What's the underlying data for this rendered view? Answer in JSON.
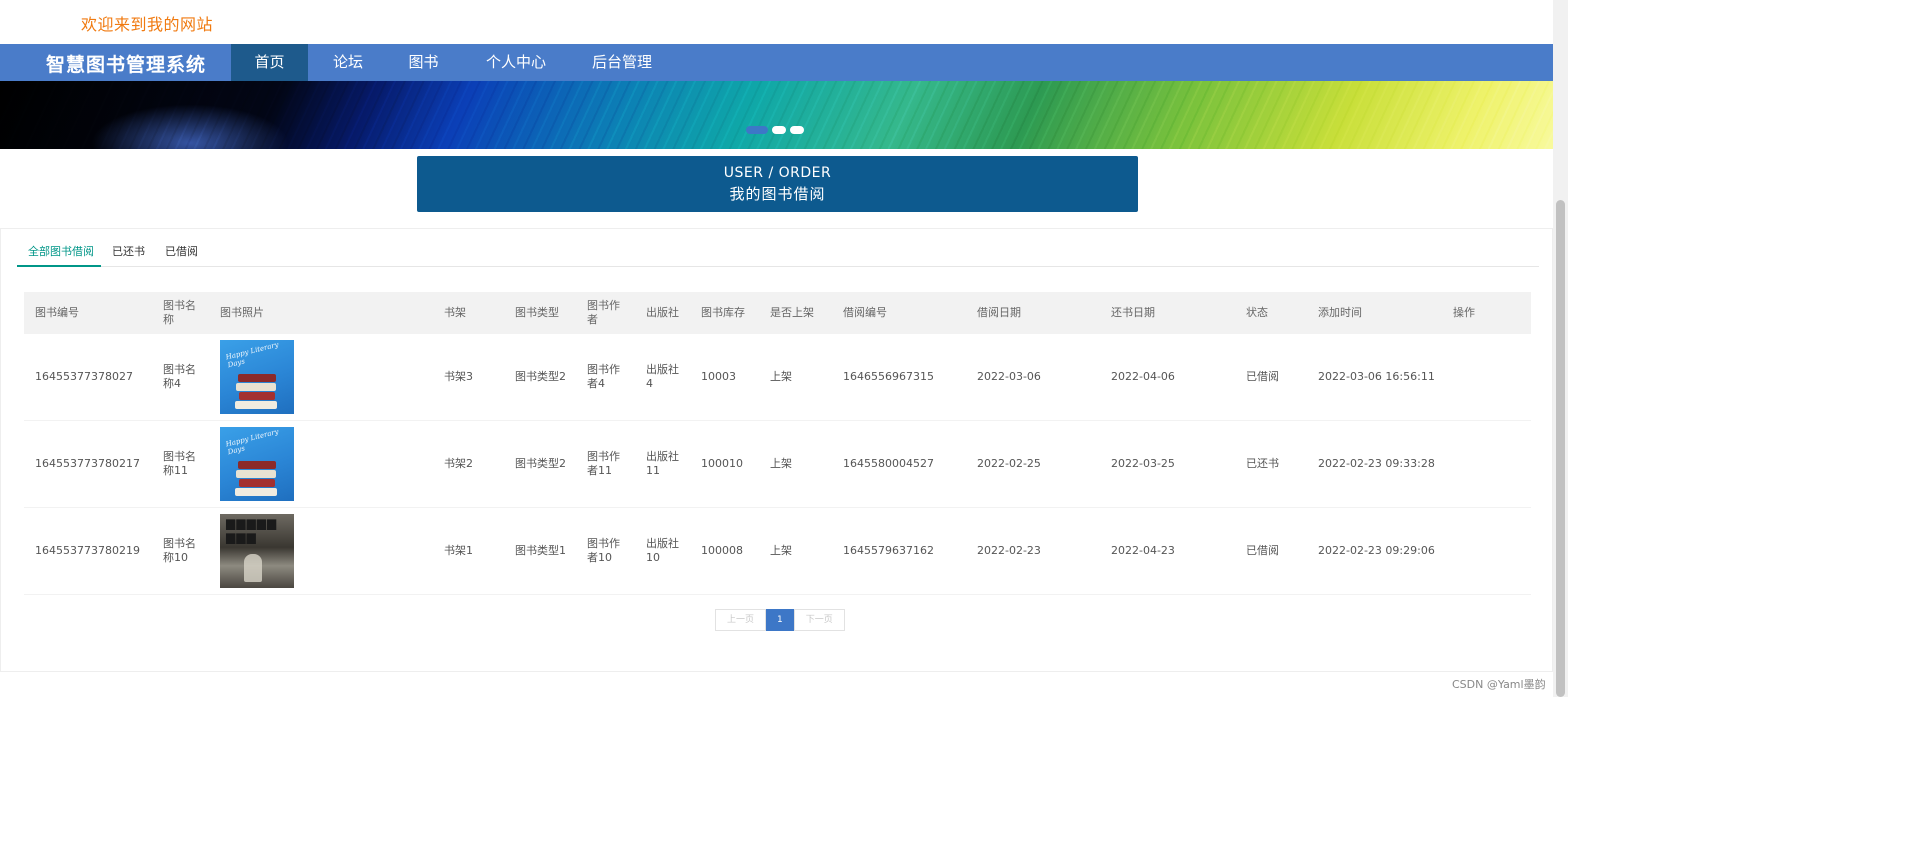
{
  "welcome_text": "欢迎来到我的网站",
  "nav": {
    "brand": "智慧图书管理系统",
    "items": [
      "首页",
      "论坛",
      "图书",
      "个人中心",
      "后台管理"
    ]
  },
  "title": {
    "en": "USER / ORDER",
    "cn": "我的图书借阅"
  },
  "tabs": [
    "全部图书借阅",
    "已还书",
    "已借阅"
  ],
  "table": {
    "headers": [
      "图书编号",
      "图书名称",
      "图书照片",
      "书架",
      "图书类型",
      "图书作者",
      "出版社",
      "图书库存",
      "是否上架",
      "借阅编号",
      "借阅日期",
      "还书日期",
      "状态",
      "添加时间",
      "操作"
    ],
    "rows": [
      {
        "book_no": "16455377378027",
        "book_name": "图书名称4",
        "shelf": "书架3",
        "type": "图书类型2",
        "author": "图书作者4",
        "publisher": "出版社4",
        "stock": "10003",
        "listed": "上架",
        "borrow_no": "1646556967315",
        "borrow_date": "2022-03-06",
        "return_date": "2022-04-06",
        "status": "已借阅",
        "added": "2022-03-06 16:56:11",
        "cover": "blue-books"
      },
      {
        "book_no": "164553773780217",
        "book_name": "图书名称11",
        "shelf": "书架2",
        "type": "图书类型2",
        "author": "图书作者11",
        "publisher": "出版社11",
        "stock": "100010",
        "listed": "上架",
        "borrow_no": "1645580004527",
        "borrow_date": "2022-02-25",
        "return_date": "2022-03-25",
        "status": "已还书",
        "added": "2022-02-23 09:33:28",
        "cover": "blue-books"
      },
      {
        "book_no": "164553773780219",
        "book_name": "图书名称10",
        "shelf": "书架1",
        "type": "图书类型1",
        "author": "图书作者10",
        "publisher": "出版社10",
        "stock": "100008",
        "listed": "上架",
        "borrow_no": "1645579637162",
        "borrow_date": "2022-02-23",
        "return_date": "2022-04-23",
        "status": "已借阅",
        "added": "2022-02-23 09:29:06",
        "cover": "dark-photo"
      }
    ]
  },
  "pagination": {
    "prev": "上一页",
    "current": "1",
    "next": "下一页"
  },
  "watermark": "CSDN @Yaml墨韵",
  "colors": {
    "nav_bg": "#4a7cc9",
    "nav_active": "#1e5a8c",
    "title_box": "#0d5a8f",
    "welcome": "#f07a10",
    "tab_active": "#009688",
    "pager_active": "#3d77c7"
  }
}
